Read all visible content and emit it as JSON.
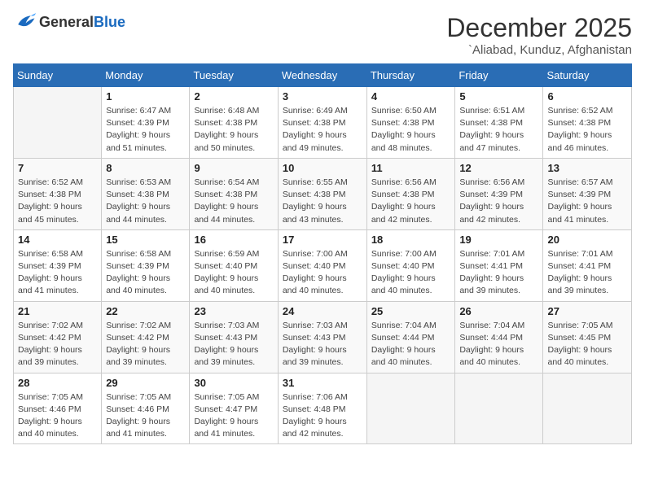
{
  "header": {
    "logo_general": "General",
    "logo_blue": "Blue",
    "month_title": "December 2025",
    "location": "`Aliabad, Kunduz, Afghanistan"
  },
  "days_of_week": [
    "Sunday",
    "Monday",
    "Tuesday",
    "Wednesday",
    "Thursday",
    "Friday",
    "Saturday"
  ],
  "weeks": [
    [
      {
        "day": "",
        "info": ""
      },
      {
        "day": "1",
        "info": "Sunrise: 6:47 AM\nSunset: 4:39 PM\nDaylight: 9 hours\nand 51 minutes."
      },
      {
        "day": "2",
        "info": "Sunrise: 6:48 AM\nSunset: 4:38 PM\nDaylight: 9 hours\nand 50 minutes."
      },
      {
        "day": "3",
        "info": "Sunrise: 6:49 AM\nSunset: 4:38 PM\nDaylight: 9 hours\nand 49 minutes."
      },
      {
        "day": "4",
        "info": "Sunrise: 6:50 AM\nSunset: 4:38 PM\nDaylight: 9 hours\nand 48 minutes."
      },
      {
        "day": "5",
        "info": "Sunrise: 6:51 AM\nSunset: 4:38 PM\nDaylight: 9 hours\nand 47 minutes."
      },
      {
        "day": "6",
        "info": "Sunrise: 6:52 AM\nSunset: 4:38 PM\nDaylight: 9 hours\nand 46 minutes."
      }
    ],
    [
      {
        "day": "7",
        "info": "Sunrise: 6:52 AM\nSunset: 4:38 PM\nDaylight: 9 hours\nand 45 minutes."
      },
      {
        "day": "8",
        "info": "Sunrise: 6:53 AM\nSunset: 4:38 PM\nDaylight: 9 hours\nand 44 minutes."
      },
      {
        "day": "9",
        "info": "Sunrise: 6:54 AM\nSunset: 4:38 PM\nDaylight: 9 hours\nand 44 minutes."
      },
      {
        "day": "10",
        "info": "Sunrise: 6:55 AM\nSunset: 4:38 PM\nDaylight: 9 hours\nand 43 minutes."
      },
      {
        "day": "11",
        "info": "Sunrise: 6:56 AM\nSunset: 4:38 PM\nDaylight: 9 hours\nand 42 minutes."
      },
      {
        "day": "12",
        "info": "Sunrise: 6:56 AM\nSunset: 4:39 PM\nDaylight: 9 hours\nand 42 minutes."
      },
      {
        "day": "13",
        "info": "Sunrise: 6:57 AM\nSunset: 4:39 PM\nDaylight: 9 hours\nand 41 minutes."
      }
    ],
    [
      {
        "day": "14",
        "info": "Sunrise: 6:58 AM\nSunset: 4:39 PM\nDaylight: 9 hours\nand 41 minutes."
      },
      {
        "day": "15",
        "info": "Sunrise: 6:58 AM\nSunset: 4:39 PM\nDaylight: 9 hours\nand 40 minutes."
      },
      {
        "day": "16",
        "info": "Sunrise: 6:59 AM\nSunset: 4:40 PM\nDaylight: 9 hours\nand 40 minutes."
      },
      {
        "day": "17",
        "info": "Sunrise: 7:00 AM\nSunset: 4:40 PM\nDaylight: 9 hours\nand 40 minutes."
      },
      {
        "day": "18",
        "info": "Sunrise: 7:00 AM\nSunset: 4:40 PM\nDaylight: 9 hours\nand 40 minutes."
      },
      {
        "day": "19",
        "info": "Sunrise: 7:01 AM\nSunset: 4:41 PM\nDaylight: 9 hours\nand 39 minutes."
      },
      {
        "day": "20",
        "info": "Sunrise: 7:01 AM\nSunset: 4:41 PM\nDaylight: 9 hours\nand 39 minutes."
      }
    ],
    [
      {
        "day": "21",
        "info": "Sunrise: 7:02 AM\nSunset: 4:42 PM\nDaylight: 9 hours\nand 39 minutes."
      },
      {
        "day": "22",
        "info": "Sunrise: 7:02 AM\nSunset: 4:42 PM\nDaylight: 9 hours\nand 39 minutes."
      },
      {
        "day": "23",
        "info": "Sunrise: 7:03 AM\nSunset: 4:43 PM\nDaylight: 9 hours\nand 39 minutes."
      },
      {
        "day": "24",
        "info": "Sunrise: 7:03 AM\nSunset: 4:43 PM\nDaylight: 9 hours\nand 39 minutes."
      },
      {
        "day": "25",
        "info": "Sunrise: 7:04 AM\nSunset: 4:44 PM\nDaylight: 9 hours\nand 40 minutes."
      },
      {
        "day": "26",
        "info": "Sunrise: 7:04 AM\nSunset: 4:44 PM\nDaylight: 9 hours\nand 40 minutes."
      },
      {
        "day": "27",
        "info": "Sunrise: 7:05 AM\nSunset: 4:45 PM\nDaylight: 9 hours\nand 40 minutes."
      }
    ],
    [
      {
        "day": "28",
        "info": "Sunrise: 7:05 AM\nSunset: 4:46 PM\nDaylight: 9 hours\nand 40 minutes."
      },
      {
        "day": "29",
        "info": "Sunrise: 7:05 AM\nSunset: 4:46 PM\nDaylight: 9 hours\nand 41 minutes."
      },
      {
        "day": "30",
        "info": "Sunrise: 7:05 AM\nSunset: 4:47 PM\nDaylight: 9 hours\nand 41 minutes."
      },
      {
        "day": "31",
        "info": "Sunrise: 7:06 AM\nSunset: 4:48 PM\nDaylight: 9 hours\nand 42 minutes."
      },
      {
        "day": "",
        "info": ""
      },
      {
        "day": "",
        "info": ""
      },
      {
        "day": "",
        "info": ""
      }
    ]
  ]
}
